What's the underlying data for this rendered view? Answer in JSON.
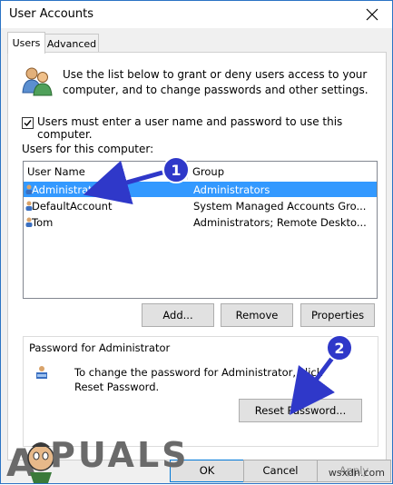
{
  "window": {
    "title": "User Accounts"
  },
  "tabs": [
    {
      "label": "Users"
    },
    {
      "label": "Advanced"
    }
  ],
  "intro_text": "Use the list below to grant or deny users access to your computer, and to change passwords and other settings.",
  "checkbox": {
    "label": "Users must enter a user name and password to use this computer.",
    "checked": true
  },
  "users_label": "Users for this computer:",
  "list": {
    "columns": [
      "User Name",
      "Group"
    ],
    "rows": [
      {
        "name": "Administrator",
        "group": "Administrators",
        "selected": true
      },
      {
        "name": "DefaultAccount",
        "group": "System Managed Accounts Gro...",
        "selected": false
      },
      {
        "name": "Tom",
        "group": "Administrators; Remote Deskto...",
        "selected": false
      }
    ]
  },
  "buttons": {
    "add": "Add...",
    "remove": "Remove",
    "properties": "Properties"
  },
  "password_section": {
    "title": "Password for Administrator",
    "text": "To change the password for Administrator, click Reset Password.",
    "reset_button": "Reset Password..."
  },
  "footer": {
    "ok": "OK",
    "cancel": "Cancel",
    "apply": "Apply"
  },
  "annotations": [
    {
      "label": "1"
    },
    {
      "label": "2"
    }
  ],
  "watermark": {
    "text": "A PUALS",
    "site": "wsxdn.com"
  },
  "colors": {
    "selection": "#3399ff",
    "arrow": "#2f38c9",
    "accent": "#0078d7"
  }
}
